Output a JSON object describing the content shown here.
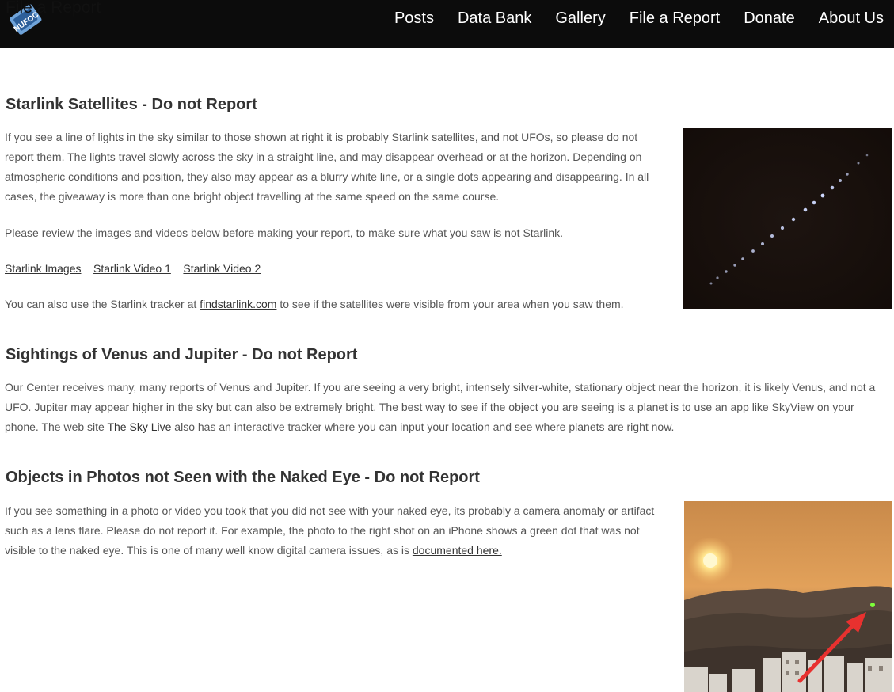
{
  "header": {
    "logo_alt": "NUFOC",
    "logo_text": "File a Report",
    "nav": [
      "Posts",
      "Data Bank",
      "Gallery",
      "File a Report",
      "Donate",
      "About Us"
    ]
  },
  "section1": {
    "title": "Starlink Satellites - Do not Report",
    "p1": "If you see a line of lights in the sky similar to those shown at right it is probably Starlink satellites, and not UFOs, so please do not report them.     The lights travel slowly across the sky in a straight line, and may disappear overhead or at the horizon.   Depending on atmospheric conditions and position, they also may appear as a blurry white line, or a single dots appearing and disappearing.   In all cases, the giveaway is more than one bright object travelling at the same speed on the same course.",
    "p2": "Please review the images and videos below before making your report, to make sure what you saw is not Starlink.",
    "links": [
      "Starlink Images",
      "Starlink Video 1",
      "Starlink Video 2"
    ],
    "p3_before": "You can also use the Starlink tracker at ",
    "p3_link": "findstarlink.com",
    "p3_after": " to see if the satellites were visible from your area when you saw them."
  },
  "section2": {
    "title": "Sightings of Venus and Jupiter - Do not Report",
    "p_before": "Our Center receives many, many reports of Venus and Jupiter.   If you are seeing a very bright, intensely silver-white, stationary object near the horizon, it is likely Venus, and not a UFO.   Jupiter may appear higher in the sky but can also be extremely bright.   The best way to see if the object you are seeing is a planet is to use an app like SkyView on your phone.   The web site ",
    "p_link": "The Sky Live",
    "p_after": " also has an interactive tracker where you can input your location and see where planets are right now."
  },
  "section3": {
    "title": "Objects in Photos not Seen with the Naked Eye - Do not Report",
    "p_before": "If you see something in a photo or video you took that you did not see with your naked eye, its probably a camera anomaly or artifact such as a lens flare.   Please do not report it.   For example, the photo to the right shot on an iPhone shows a green dot that was not visible to the naked eye.   This is one of many well know digital camera issues, as is ",
    "p_link": "documented here."
  },
  "colors": {
    "topbar": "#0c0c0c",
    "heading": "#333333",
    "body_text": "#555555",
    "arrow": "#e8312f",
    "green_dot": "#7dff3a"
  }
}
